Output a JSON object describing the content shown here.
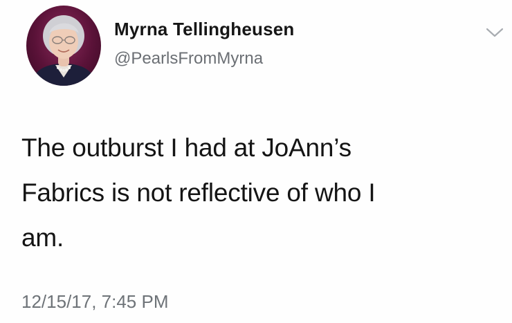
{
  "user": {
    "display_name": "Myrna Tellingheusen",
    "handle": "@PearlsFromMyrna"
  },
  "tweet": {
    "lines": [
      "The outburst I had at JoAnn’s",
      "Fabrics is not reflective of who I",
      "am."
    ],
    "timestamp": "12/15/17, 7:45 PM"
  },
  "icons": {
    "menu": "chevron-down-icon",
    "avatar": "profile-photo"
  },
  "colors": {
    "name": "#161616",
    "secondary": "#6b6f74",
    "avatar_background": "#5a1238"
  }
}
